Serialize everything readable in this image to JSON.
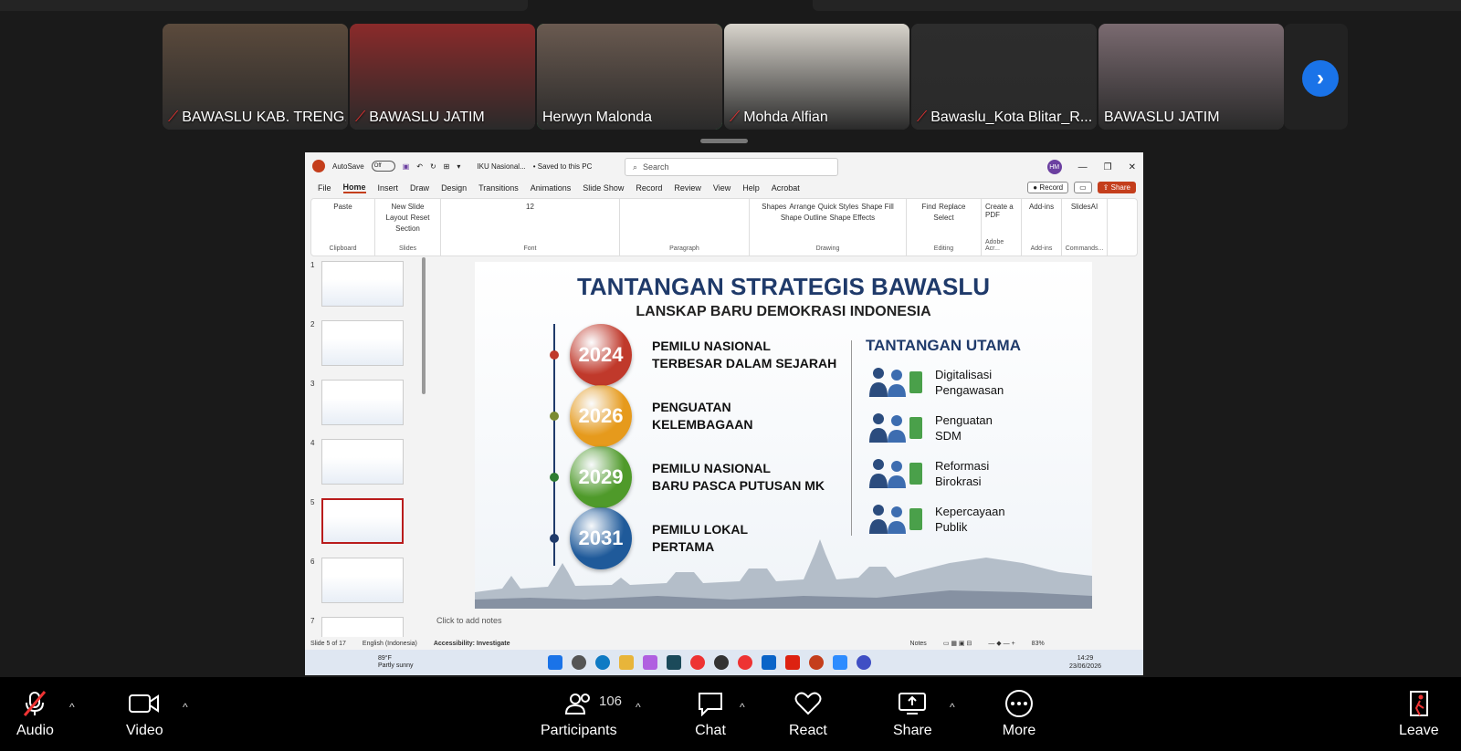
{
  "participants_gallery": [
    {
      "name": "BAWASLU KAB. TRENG...",
      "muted": true,
      "bg": "#5b4a3c"
    },
    {
      "name": "BAWASLU JATIM",
      "muted": true,
      "bg": "#8a2a2a"
    },
    {
      "name": "Herwyn Malonda",
      "muted": false,
      "active": true,
      "bg": "#6a5a50"
    },
    {
      "name": "Mohda Alfian",
      "muted": true,
      "bg": "#d8d4cc"
    },
    {
      "name": "Bawaslu_Kota Blitar_R...",
      "muted": true,
      "bg": "#2d2d2d"
    },
    {
      "name": "BAWASLU JATIM",
      "muted": false,
      "bg": "#7a6a70"
    }
  ],
  "powerpoint": {
    "autosave_label": "AutoSave",
    "autosave_state": "Off",
    "file_name": "IKU Nasional...",
    "save_status": "• Saved to this PC",
    "search_placeholder": "Search",
    "user_initials": "HM",
    "menu": [
      "File",
      "Home",
      "Insert",
      "Draw",
      "Design",
      "Transitions",
      "Animations",
      "Slide Show",
      "Record",
      "Review",
      "View",
      "Help",
      "Acrobat"
    ],
    "active_menu": "Home",
    "record_label": "Record",
    "share_label": "Share",
    "ribbon_groups": [
      {
        "name": "Clipboard",
        "items": [
          "Paste"
        ]
      },
      {
        "name": "Slides",
        "items": [
          "New Slide",
          "Layout",
          "Reset",
          "Section"
        ]
      },
      {
        "name": "Font",
        "items": [
          "12"
        ]
      },
      {
        "name": "Paragraph",
        "items": []
      },
      {
        "name": "Drawing",
        "items": [
          "Shapes",
          "Arrange",
          "Quick Styles",
          "Shape Fill",
          "Shape Outline",
          "Shape Effects"
        ]
      },
      {
        "name": "Editing",
        "items": [
          "Find",
          "Replace",
          "Select"
        ]
      },
      {
        "name": "Adobe Acr...",
        "items": [
          "Create a PDF"
        ]
      },
      {
        "name": "Add-ins",
        "items": [
          "Add-ins"
        ]
      },
      {
        "name": "Commands...",
        "items": [
          "SlidesAI"
        ]
      }
    ],
    "thumbnails": [
      "1",
      "2",
      "3",
      "4",
      "5",
      "6",
      "7"
    ],
    "selected_slide": "5",
    "slide": {
      "title": "TANTANGAN STRATEGIS BAWASLU",
      "subtitle": "LANSKAP BARU DEMOKRASI INDONESIA",
      "timeline": [
        {
          "year": "2024",
          "text": "PEMILU NASIONAL\nTERBESAR DALAM SEJARAH",
          "color": "#c0392b",
          "dot": "#c0392b"
        },
        {
          "year": "2026",
          "text": "PENGUATAN\nKELEMBAGAAN",
          "color": "#e69a1c",
          "dot": "#7a8a30"
        },
        {
          "year": "2029",
          "text": "PEMILU NASIONAL\nBARU PASCA PUTUSAN MK",
          "color": "#4f9a2a",
          "dot": "#2e7d32"
        },
        {
          "year": "2031",
          "text": "PEMILU LOKAL\nPERTAMA",
          "color": "#1f5a9a",
          "dot": "#1f3a6a"
        }
      ],
      "challenges_title": "TANTANGAN UTAMA",
      "challenges": [
        {
          "text": "Digitalisasi\nPengawasan",
          "icon": "digital-monitoring-icon"
        },
        {
          "text": "Penguatan\nSDM",
          "icon": "people-growth-icon"
        },
        {
          "text": "Reformasi\nBirokrasi",
          "icon": "org-chart-icon"
        },
        {
          "text": "Kepercayaan\nPublik",
          "icon": "handshake-icon"
        }
      ]
    },
    "notes_placeholder": "Click to add notes",
    "status": {
      "slide_count": "Slide 5 of 17",
      "language": "English (Indonesia)",
      "accessibility": "Accessibility: Investigate",
      "notes": "Notes",
      "zoom": "83%"
    },
    "taskbar": {
      "weather_temp": "89°F",
      "weather_desc": "Partly sunny",
      "time": "14:29",
      "date": "23/06/2026"
    }
  },
  "controls": {
    "audio": "Audio",
    "video": "Video",
    "participants": "Participants",
    "participants_count": "106",
    "chat": "Chat",
    "react": "React",
    "share": "Share",
    "more": "More",
    "leave": "Leave"
  }
}
